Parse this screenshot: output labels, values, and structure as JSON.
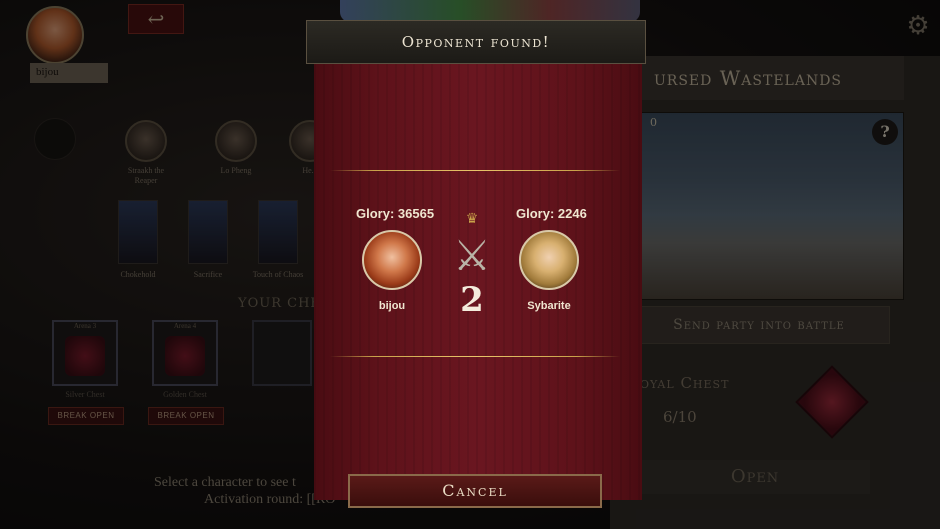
{
  "player": {
    "name": "bijou"
  },
  "background": {
    "heroes": [
      {
        "label": "Straakh the Reaper"
      },
      {
        "label": "Lo Pheng"
      },
      {
        "label": "He..."
      }
    ],
    "cards": [
      {
        "label": "Chokehold"
      },
      {
        "label": "Sacrifice"
      },
      {
        "label": "Touch of Chaos"
      }
    ],
    "chests_title": "YOUR CHES",
    "chests": [
      {
        "title": "Arena 3",
        "name": "Silver Chest",
        "button": "BREAK OPEN"
      },
      {
        "title": "Arena 4",
        "name": "Golden Chest",
        "button": "BREAK OPEN"
      }
    ],
    "hint_line1": "Select a character to see t",
    "hint_line2": "Activation round: [[RO"
  },
  "right_panel": {
    "title": "ursed Wastelands",
    "map_number": "0",
    "help": "?",
    "send_button": "Send party into battle",
    "chest_label": "oyal Chest",
    "chest_count": "6/10",
    "open_button": "Open"
  },
  "modal": {
    "title": "Opponent found!",
    "left": {
      "glory": "Glory: 36565",
      "name": "bijou"
    },
    "right": {
      "glory": "Glory: 2246",
      "name": "Sybarite"
    },
    "round": "2",
    "cancel_button": "Cancel"
  }
}
